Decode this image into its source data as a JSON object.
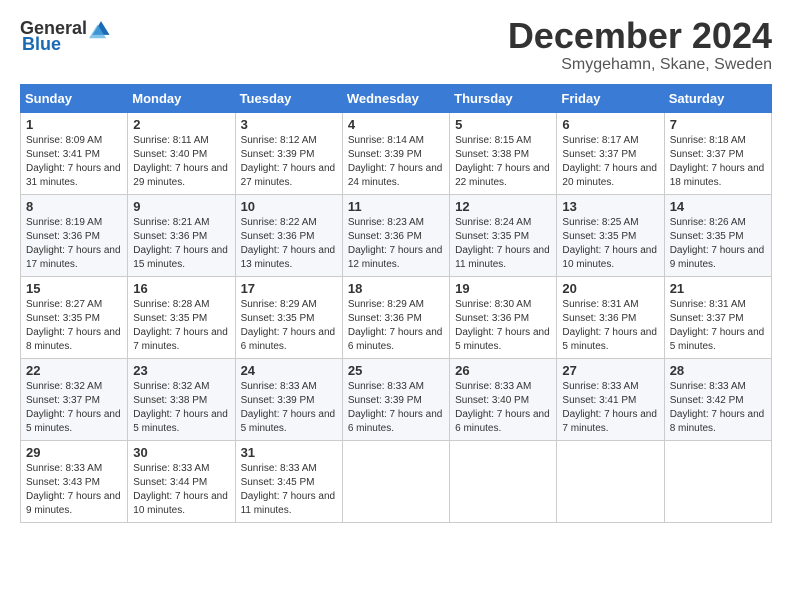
{
  "header": {
    "logo_general": "General",
    "logo_blue": "Blue",
    "month": "December 2024",
    "location": "Smygehamn, Skane, Sweden"
  },
  "days_of_week": [
    "Sunday",
    "Monday",
    "Tuesday",
    "Wednesday",
    "Thursday",
    "Friday",
    "Saturday"
  ],
  "weeks": [
    [
      {
        "day": "1",
        "sunrise": "Sunrise: 8:09 AM",
        "sunset": "Sunset: 3:41 PM",
        "daylight": "Daylight: 7 hours and 31 minutes."
      },
      {
        "day": "2",
        "sunrise": "Sunrise: 8:11 AM",
        "sunset": "Sunset: 3:40 PM",
        "daylight": "Daylight: 7 hours and 29 minutes."
      },
      {
        "day": "3",
        "sunrise": "Sunrise: 8:12 AM",
        "sunset": "Sunset: 3:39 PM",
        "daylight": "Daylight: 7 hours and 27 minutes."
      },
      {
        "day": "4",
        "sunrise": "Sunrise: 8:14 AM",
        "sunset": "Sunset: 3:39 PM",
        "daylight": "Daylight: 7 hours and 24 minutes."
      },
      {
        "day": "5",
        "sunrise": "Sunrise: 8:15 AM",
        "sunset": "Sunset: 3:38 PM",
        "daylight": "Daylight: 7 hours and 22 minutes."
      },
      {
        "day": "6",
        "sunrise": "Sunrise: 8:17 AM",
        "sunset": "Sunset: 3:37 PM",
        "daylight": "Daylight: 7 hours and 20 minutes."
      },
      {
        "day": "7",
        "sunrise": "Sunrise: 8:18 AM",
        "sunset": "Sunset: 3:37 PM",
        "daylight": "Daylight: 7 hours and 18 minutes."
      }
    ],
    [
      {
        "day": "8",
        "sunrise": "Sunrise: 8:19 AM",
        "sunset": "Sunset: 3:36 PM",
        "daylight": "Daylight: 7 hours and 17 minutes."
      },
      {
        "day": "9",
        "sunrise": "Sunrise: 8:21 AM",
        "sunset": "Sunset: 3:36 PM",
        "daylight": "Daylight: 7 hours and 15 minutes."
      },
      {
        "day": "10",
        "sunrise": "Sunrise: 8:22 AM",
        "sunset": "Sunset: 3:36 PM",
        "daylight": "Daylight: 7 hours and 13 minutes."
      },
      {
        "day": "11",
        "sunrise": "Sunrise: 8:23 AM",
        "sunset": "Sunset: 3:36 PM",
        "daylight": "Daylight: 7 hours and 12 minutes."
      },
      {
        "day": "12",
        "sunrise": "Sunrise: 8:24 AM",
        "sunset": "Sunset: 3:35 PM",
        "daylight": "Daylight: 7 hours and 11 minutes."
      },
      {
        "day": "13",
        "sunrise": "Sunrise: 8:25 AM",
        "sunset": "Sunset: 3:35 PM",
        "daylight": "Daylight: 7 hours and 10 minutes."
      },
      {
        "day": "14",
        "sunrise": "Sunrise: 8:26 AM",
        "sunset": "Sunset: 3:35 PM",
        "daylight": "Daylight: 7 hours and 9 minutes."
      }
    ],
    [
      {
        "day": "15",
        "sunrise": "Sunrise: 8:27 AM",
        "sunset": "Sunset: 3:35 PM",
        "daylight": "Daylight: 7 hours and 8 minutes."
      },
      {
        "day": "16",
        "sunrise": "Sunrise: 8:28 AM",
        "sunset": "Sunset: 3:35 PM",
        "daylight": "Daylight: 7 hours and 7 minutes."
      },
      {
        "day": "17",
        "sunrise": "Sunrise: 8:29 AM",
        "sunset": "Sunset: 3:35 PM",
        "daylight": "Daylight: 7 hours and 6 minutes."
      },
      {
        "day": "18",
        "sunrise": "Sunrise: 8:29 AM",
        "sunset": "Sunset: 3:36 PM",
        "daylight": "Daylight: 7 hours and 6 minutes."
      },
      {
        "day": "19",
        "sunrise": "Sunrise: 8:30 AM",
        "sunset": "Sunset: 3:36 PM",
        "daylight": "Daylight: 7 hours and 5 minutes."
      },
      {
        "day": "20",
        "sunrise": "Sunrise: 8:31 AM",
        "sunset": "Sunset: 3:36 PM",
        "daylight": "Daylight: 7 hours and 5 minutes."
      },
      {
        "day": "21",
        "sunrise": "Sunrise: 8:31 AM",
        "sunset": "Sunset: 3:37 PM",
        "daylight": "Daylight: 7 hours and 5 minutes."
      }
    ],
    [
      {
        "day": "22",
        "sunrise": "Sunrise: 8:32 AM",
        "sunset": "Sunset: 3:37 PM",
        "daylight": "Daylight: 7 hours and 5 minutes."
      },
      {
        "day": "23",
        "sunrise": "Sunrise: 8:32 AM",
        "sunset": "Sunset: 3:38 PM",
        "daylight": "Daylight: 7 hours and 5 minutes."
      },
      {
        "day": "24",
        "sunrise": "Sunrise: 8:33 AM",
        "sunset": "Sunset: 3:39 PM",
        "daylight": "Daylight: 7 hours and 5 minutes."
      },
      {
        "day": "25",
        "sunrise": "Sunrise: 8:33 AM",
        "sunset": "Sunset: 3:39 PM",
        "daylight": "Daylight: 7 hours and 6 minutes."
      },
      {
        "day": "26",
        "sunrise": "Sunrise: 8:33 AM",
        "sunset": "Sunset: 3:40 PM",
        "daylight": "Daylight: 7 hours and 6 minutes."
      },
      {
        "day": "27",
        "sunrise": "Sunrise: 8:33 AM",
        "sunset": "Sunset: 3:41 PM",
        "daylight": "Daylight: 7 hours and 7 minutes."
      },
      {
        "day": "28",
        "sunrise": "Sunrise: 8:33 AM",
        "sunset": "Sunset: 3:42 PM",
        "daylight": "Daylight: 7 hours and 8 minutes."
      }
    ],
    [
      {
        "day": "29",
        "sunrise": "Sunrise: 8:33 AM",
        "sunset": "Sunset: 3:43 PM",
        "daylight": "Daylight: 7 hours and 9 minutes."
      },
      {
        "day": "30",
        "sunrise": "Sunrise: 8:33 AM",
        "sunset": "Sunset: 3:44 PM",
        "daylight": "Daylight: 7 hours and 10 minutes."
      },
      {
        "day": "31",
        "sunrise": "Sunrise: 8:33 AM",
        "sunset": "Sunset: 3:45 PM",
        "daylight": "Daylight: 7 hours and 11 minutes."
      },
      null,
      null,
      null,
      null
    ]
  ]
}
